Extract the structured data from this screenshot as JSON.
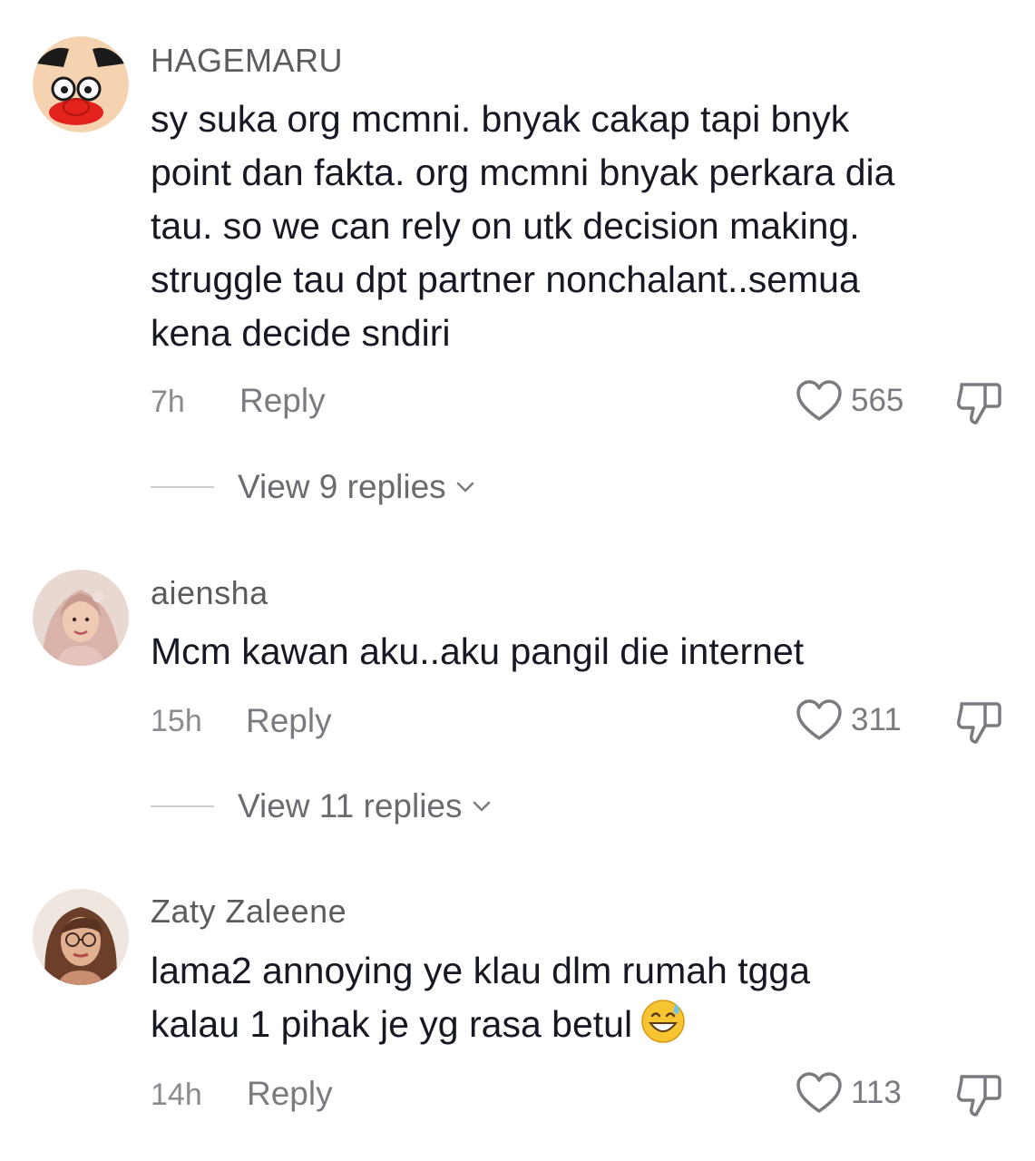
{
  "comments": [
    {
      "username": "HAGEMARU",
      "text": "sy suka org mcmni. bnyak cakap tapi bnyk\npoint dan fakta. org mcmni bnyak perkara dia\ntau. so we can rely on utk decision making.\nstruggle tau dpt partner nonchalant..semua\nkena decide sndiri",
      "time": "7h",
      "reply_label": "Reply",
      "likes": "565",
      "view_replies": "View 9 replies"
    },
    {
      "username": "aiensha",
      "text": "Mcm kawan aku..aku pangil die internet",
      "time": "15h",
      "reply_label": "Reply",
      "likes": "311",
      "view_replies": "View 11 replies"
    },
    {
      "username": "Zaty Zaleene",
      "text": "lama2 annoying ye klau dlm rumah tgga\nkalau 1 pihak je yg rasa betul",
      "emoji": "grinning-sweat-emoji",
      "time": "14h",
      "reply_label": "Reply",
      "likes": "113"
    }
  ],
  "icons": {
    "like": "heart-outline-icon",
    "dislike": "thumbs-down-icon",
    "expand": "chevron-down-icon"
  },
  "colors": {
    "text": "#161823",
    "secondary": "#7a7b80",
    "background": "#ffffff"
  }
}
